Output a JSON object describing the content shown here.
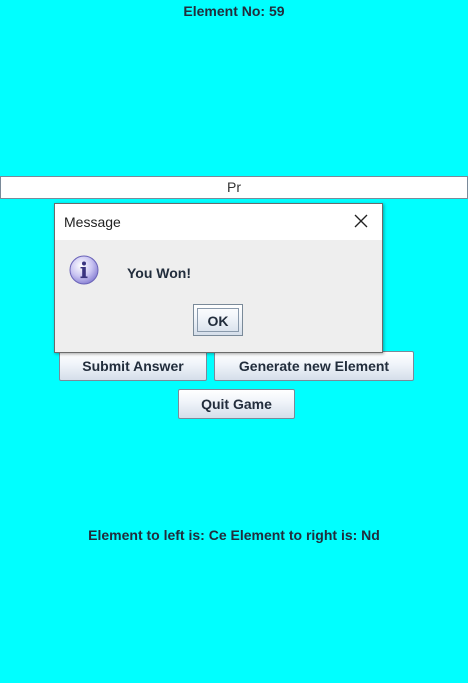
{
  "header": {
    "element_no": "Element No: 59"
  },
  "answer_input": {
    "value": "Pr"
  },
  "buttons": {
    "submit": "Submit Answer",
    "generate": "Generate new Element",
    "quit": "Quit Game"
  },
  "neighbors": {
    "text": "Element to left is: Ce Element to right is: Nd"
  },
  "dialog": {
    "title": "Message",
    "message": "You Won!",
    "ok_label": "OK",
    "icon": "info-icon",
    "close_icon": "close-icon"
  },
  "colors": {
    "background": "#00ffff",
    "dialog_background": "#eeeeee",
    "text": "#222d3c"
  }
}
